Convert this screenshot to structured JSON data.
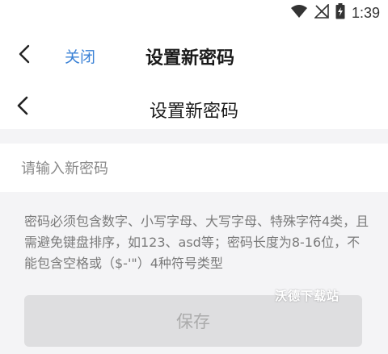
{
  "status_bar": {
    "time": "1:39",
    "icons": [
      "wifi-icon",
      "signal-off-icon",
      "battery-charging-icon"
    ]
  },
  "app_header": {
    "back_icon": "chevron-left-icon",
    "close_label": "关闭",
    "title": "设置新密码"
  },
  "page_header": {
    "back_icon": "chevron-left-icon",
    "title": "设置新密码"
  },
  "password_input": {
    "placeholder": "请输入新密码",
    "value": ""
  },
  "rules": {
    "text": "密码必须包含数字、小写字母、大写字母、特殊字符4类，且需避免键盘排序，如123、asd等；密码长度为8-16位，不能包含空格或（$-'\"）4种符号类型"
  },
  "watermark": "沃德下载站",
  "save_button": {
    "label": "保存"
  },
  "colors": {
    "accent": "#3b82d6",
    "page_bg": "#f4f4f6",
    "disabled_button": "#dedee0",
    "disabled_text": "#ababab"
  }
}
